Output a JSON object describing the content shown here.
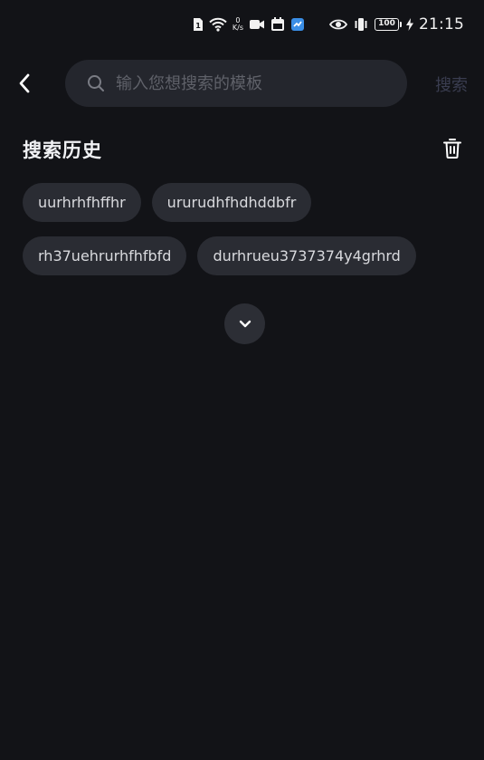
{
  "status_bar": {
    "net_speed_value": "0",
    "net_speed_unit": "K/s",
    "battery_level": "100",
    "time": "21:15"
  },
  "search": {
    "placeholder": "输入您想搜索的模板",
    "value": "",
    "button_label": "搜索"
  },
  "history": {
    "title": "搜索历史",
    "items": [
      "uurhrhfhffhr",
      "ururudhfhdhddbfr",
      "rh37uehrurhfhfbfd",
      "durhrueu3737374y4grhrd"
    ]
  },
  "colors": {
    "background": "#121317",
    "search_box": "#24262d",
    "tag_bg": "#2a2c33"
  }
}
